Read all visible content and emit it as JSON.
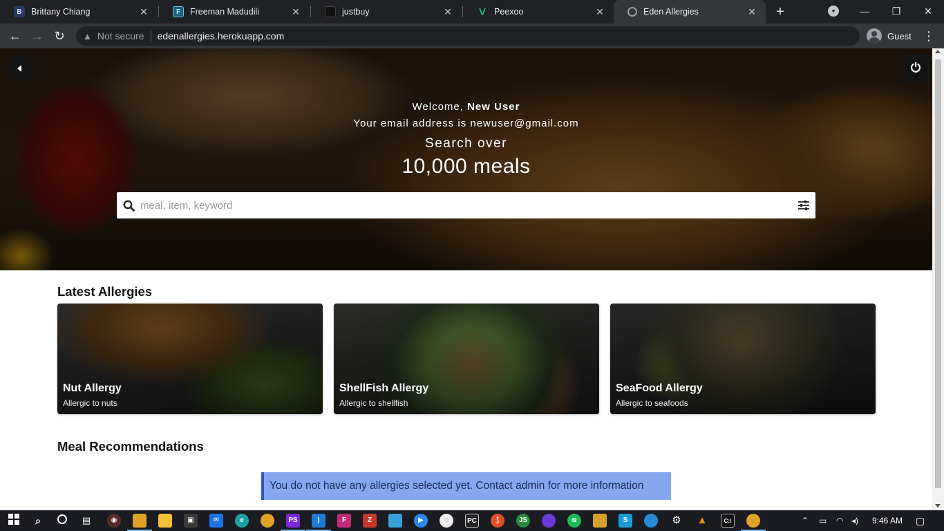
{
  "browser": {
    "tabs": [
      {
        "title": "Brittany Chiang",
        "favicon_letter": "B",
        "favicon_color": "#2a3a66"
      },
      {
        "title": "Freeman Madudili",
        "favicon_letter": "F",
        "favicon_color": "#1f5f78"
      },
      {
        "title": "justbuy",
        "favicon_letter": "",
        "favicon_color": "#111111"
      },
      {
        "title": "Peexoo",
        "favicon_letter": "V",
        "favicon_color": "#21b27a"
      },
      {
        "title": "Eden Allergies",
        "favicon_letter": "",
        "favicon_color": "#9aa0a6"
      }
    ],
    "security_label": "Not secure",
    "url": "edenallergies.herokuapp.com",
    "profile_name": "Guest"
  },
  "hero": {
    "welcome_prefix": "Welcome, ",
    "user_name": "New User",
    "email_line": "Your email address is newuser@gmail.com",
    "search_over": "Search over",
    "meal_count": "10,000 meals",
    "search_placeholder": "meal, item, keyword"
  },
  "sections": {
    "latest_allergies": "Latest Allergies",
    "meal_recommendations": "Meal Recommendations"
  },
  "allergy_cards": [
    {
      "title": "Nut Allergy",
      "subtitle": "Allergic to nuts"
    },
    {
      "title": "ShellFish Allergy",
      "subtitle": "Allergic to shellfish"
    },
    {
      "title": "SeaFood Allergy",
      "subtitle": "Allergic to seafoods"
    }
  ],
  "alert": {
    "message": "You do not have any allergies selected yet. Contact admin for more information",
    "color": "#86a7f0"
  },
  "taskbar": {
    "time": "9:46 AM",
    "apps": [
      "start-icon",
      "search-icon",
      "cortana-icon",
      "task-view-icon",
      "media-icon",
      "file-explorer-icon",
      "folder-icon",
      "store-icon",
      "mail-icon",
      "edge-icon",
      "chrome-icon",
      "phpstorm-icon",
      "vscode-icon",
      "figma-icon",
      "filezilla-icon",
      "app-icon",
      "zoom-icon",
      "app-icon",
      "pycharm-icon",
      "git-icon",
      "app-icon",
      "github-icon",
      "spotify-icon",
      "app-icon",
      "skype-icon",
      "docker-icon",
      "settings-icon",
      "vlc-icon",
      "terminal-icon",
      "chrome-active-icon"
    ]
  }
}
